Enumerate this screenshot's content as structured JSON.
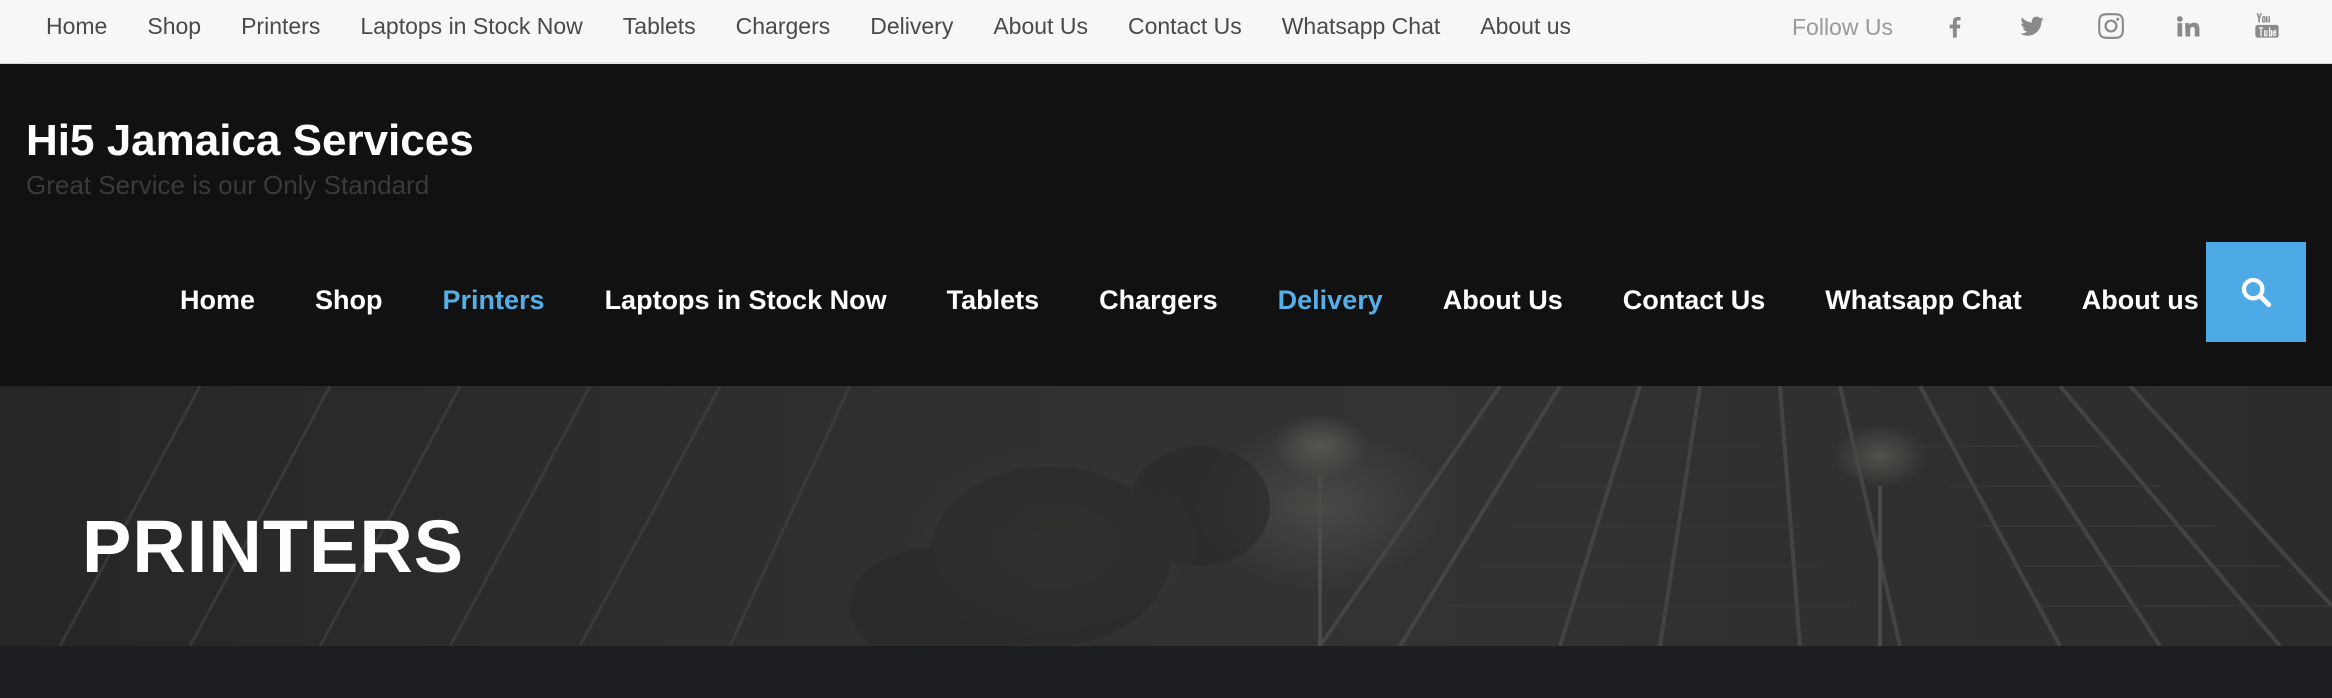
{
  "topbar": {
    "nav": [
      "Home",
      "Shop",
      "Printers",
      "Laptops in Stock Now",
      "Tablets",
      "Chargers",
      "Delivery",
      "About Us",
      "Contact Us",
      "Whatsapp Chat",
      "About us"
    ],
    "follow_label": "Follow Us",
    "social_icons": [
      "facebook-icon",
      "twitter-icon",
      "instagram-icon",
      "linkedin-icon",
      "youtube-icon"
    ]
  },
  "header": {
    "site_title": "Hi5 Jamaica Services",
    "tagline": "Great Service is our Only Standard",
    "nav": [
      {
        "label": "Home",
        "active": false
      },
      {
        "label": "Shop",
        "active": false
      },
      {
        "label": "Printers",
        "active": true
      },
      {
        "label": "Laptops in Stock Now",
        "active": false
      },
      {
        "label": "Tablets",
        "active": false
      },
      {
        "label": "Chargers",
        "active": false
      },
      {
        "label": "Delivery",
        "active": true
      },
      {
        "label": "About Us",
        "active": false
      },
      {
        "label": "Contact Us",
        "active": false
      },
      {
        "label": "Whatsapp Chat",
        "active": false
      },
      {
        "label": "About us",
        "active": false
      }
    ],
    "search_icon": "search-icon"
  },
  "hero": {
    "title": "PRINTERS"
  },
  "colors": {
    "accent": "#56aee8",
    "search_bg": "#4eaae6",
    "header_bg": "#111111",
    "topbar_bg": "#f7f7f7"
  }
}
